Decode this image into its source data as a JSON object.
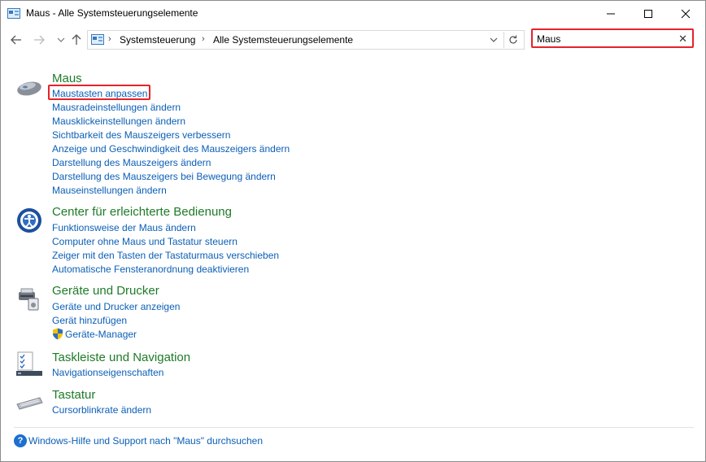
{
  "window": {
    "title": "Maus - Alle Systemsteuerungselemente"
  },
  "navigation": {
    "breadcrumbs": [
      "Systemsteuerung",
      "Alle Systemsteuerungselemente"
    ],
    "search_value": "Maus",
    "clear_symbol": "✕"
  },
  "groups": [
    {
      "title": "Maus",
      "icon": "mouse-icon",
      "links": [
        "Maustasten anpassen",
        "Mausradeinstellungen ändern",
        "Mausklickeinstellungen ändern",
        "Sichtbarkeit des Mauszeigers verbessern",
        "Anzeige und Geschwindigkeit des Mauszeigers ändern",
        "Darstellung des Mauszeigers ändern",
        "Darstellung des Mauszeigers bei Bewegung ändern",
        "Mauseinstellungen ändern"
      ]
    },
    {
      "title": "Center für erleichterte Bedienung",
      "icon": "ease-of-access-icon",
      "links": [
        "Funktionsweise der Maus ändern",
        "Computer ohne Maus und Tastatur steuern",
        "Zeiger mit den Tasten der Tastaturmaus verschieben",
        "Automatische Fensteranordnung deaktivieren"
      ]
    },
    {
      "title": "Geräte und Drucker",
      "icon": "devices-printers-icon",
      "links": [
        "Geräte und Drucker anzeigen",
        "Gerät hinzufügen",
        "Geräte-Manager"
      ]
    },
    {
      "title": "Taskleiste und Navigation",
      "icon": "taskbar-icon",
      "links": [
        "Navigationseigenschaften"
      ]
    },
    {
      "title": "Tastatur",
      "icon": "keyboard-icon",
      "links": [
        "Cursorblinkrate ändern"
      ]
    }
  ],
  "help": {
    "icon_text": "?",
    "text": "Windows-Hilfe und Support nach \"Maus\" durchsuchen"
  },
  "colors": {
    "group_title": "#1e7b28",
    "link": "#0b5fb6",
    "highlight": "#e5232a"
  }
}
